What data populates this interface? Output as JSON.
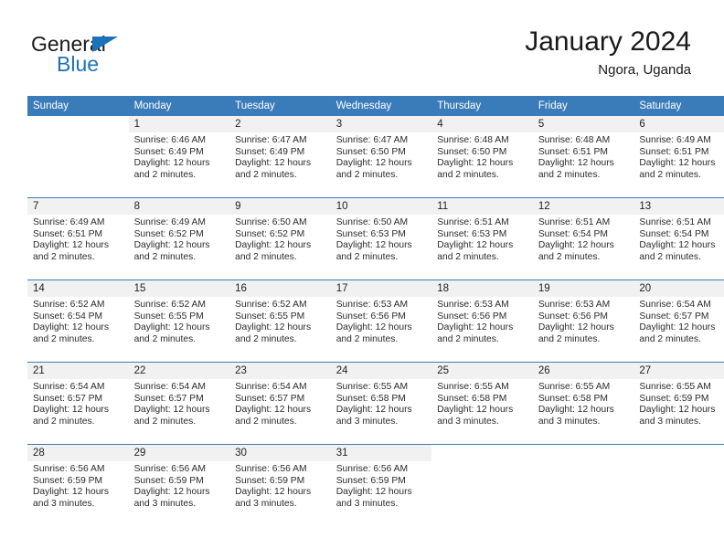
{
  "brand": {
    "name_top": "General",
    "name_bottom": "Blue",
    "triangle_color": "#1c72b8"
  },
  "header": {
    "title": "January 2024",
    "subtitle": "Ngora, Uganda",
    "accent_color": "#3a7cba",
    "daynum_band_color": "#f1f1f1"
  },
  "weekday_headers": [
    "Sunday",
    "Monday",
    "Tuesday",
    "Wednesday",
    "Thursday",
    "Friday",
    "Saturday"
  ],
  "weeks": [
    [
      {
        "day": "",
        "sunrise": "",
        "sunset": "",
        "daylight_line1": "",
        "daylight_line2": "",
        "blank": true
      },
      {
        "day": "1",
        "sunrise": "Sunrise: 6:46 AM",
        "sunset": "Sunset: 6:49 PM",
        "daylight_line1": "Daylight: 12 hours",
        "daylight_line2": "and 2 minutes.",
        "blank": false
      },
      {
        "day": "2",
        "sunrise": "Sunrise: 6:47 AM",
        "sunset": "Sunset: 6:49 PM",
        "daylight_line1": "Daylight: 12 hours",
        "daylight_line2": "and 2 minutes.",
        "blank": false
      },
      {
        "day": "3",
        "sunrise": "Sunrise: 6:47 AM",
        "sunset": "Sunset: 6:50 PM",
        "daylight_line1": "Daylight: 12 hours",
        "daylight_line2": "and 2 minutes.",
        "blank": false
      },
      {
        "day": "4",
        "sunrise": "Sunrise: 6:48 AM",
        "sunset": "Sunset: 6:50 PM",
        "daylight_line1": "Daylight: 12 hours",
        "daylight_line2": "and 2 minutes.",
        "blank": false
      },
      {
        "day": "5",
        "sunrise": "Sunrise: 6:48 AM",
        "sunset": "Sunset: 6:51 PM",
        "daylight_line1": "Daylight: 12 hours",
        "daylight_line2": "and 2 minutes.",
        "blank": false
      },
      {
        "day": "6",
        "sunrise": "Sunrise: 6:49 AM",
        "sunset": "Sunset: 6:51 PM",
        "daylight_line1": "Daylight: 12 hours",
        "daylight_line2": "and 2 minutes.",
        "blank": false
      }
    ],
    [
      {
        "day": "7",
        "sunrise": "Sunrise: 6:49 AM",
        "sunset": "Sunset: 6:51 PM",
        "daylight_line1": "Daylight: 12 hours",
        "daylight_line2": "and 2 minutes.",
        "blank": false
      },
      {
        "day": "8",
        "sunrise": "Sunrise: 6:49 AM",
        "sunset": "Sunset: 6:52 PM",
        "daylight_line1": "Daylight: 12 hours",
        "daylight_line2": "and 2 minutes.",
        "blank": false
      },
      {
        "day": "9",
        "sunrise": "Sunrise: 6:50 AM",
        "sunset": "Sunset: 6:52 PM",
        "daylight_line1": "Daylight: 12 hours",
        "daylight_line2": "and 2 minutes.",
        "blank": false
      },
      {
        "day": "10",
        "sunrise": "Sunrise: 6:50 AM",
        "sunset": "Sunset: 6:53 PM",
        "daylight_line1": "Daylight: 12 hours",
        "daylight_line2": "and 2 minutes.",
        "blank": false
      },
      {
        "day": "11",
        "sunrise": "Sunrise: 6:51 AM",
        "sunset": "Sunset: 6:53 PM",
        "daylight_line1": "Daylight: 12 hours",
        "daylight_line2": "and 2 minutes.",
        "blank": false
      },
      {
        "day": "12",
        "sunrise": "Sunrise: 6:51 AM",
        "sunset": "Sunset: 6:54 PM",
        "daylight_line1": "Daylight: 12 hours",
        "daylight_line2": "and 2 minutes.",
        "blank": false
      },
      {
        "day": "13",
        "sunrise": "Sunrise: 6:51 AM",
        "sunset": "Sunset: 6:54 PM",
        "daylight_line1": "Daylight: 12 hours",
        "daylight_line2": "and 2 minutes.",
        "blank": false
      }
    ],
    [
      {
        "day": "14",
        "sunrise": "Sunrise: 6:52 AM",
        "sunset": "Sunset: 6:54 PM",
        "daylight_line1": "Daylight: 12 hours",
        "daylight_line2": "and 2 minutes.",
        "blank": false
      },
      {
        "day": "15",
        "sunrise": "Sunrise: 6:52 AM",
        "sunset": "Sunset: 6:55 PM",
        "daylight_line1": "Daylight: 12 hours",
        "daylight_line2": "and 2 minutes.",
        "blank": false
      },
      {
        "day": "16",
        "sunrise": "Sunrise: 6:52 AM",
        "sunset": "Sunset: 6:55 PM",
        "daylight_line1": "Daylight: 12 hours",
        "daylight_line2": "and 2 minutes.",
        "blank": false
      },
      {
        "day": "17",
        "sunrise": "Sunrise: 6:53 AM",
        "sunset": "Sunset: 6:56 PM",
        "daylight_line1": "Daylight: 12 hours",
        "daylight_line2": "and 2 minutes.",
        "blank": false
      },
      {
        "day": "18",
        "sunrise": "Sunrise: 6:53 AM",
        "sunset": "Sunset: 6:56 PM",
        "daylight_line1": "Daylight: 12 hours",
        "daylight_line2": "and 2 minutes.",
        "blank": false
      },
      {
        "day": "19",
        "sunrise": "Sunrise: 6:53 AM",
        "sunset": "Sunset: 6:56 PM",
        "daylight_line1": "Daylight: 12 hours",
        "daylight_line2": "and 2 minutes.",
        "blank": false
      },
      {
        "day": "20",
        "sunrise": "Sunrise: 6:54 AM",
        "sunset": "Sunset: 6:57 PM",
        "daylight_line1": "Daylight: 12 hours",
        "daylight_line2": "and 2 minutes.",
        "blank": false
      }
    ],
    [
      {
        "day": "21",
        "sunrise": "Sunrise: 6:54 AM",
        "sunset": "Sunset: 6:57 PM",
        "daylight_line1": "Daylight: 12 hours",
        "daylight_line2": "and 2 minutes.",
        "blank": false
      },
      {
        "day": "22",
        "sunrise": "Sunrise: 6:54 AM",
        "sunset": "Sunset: 6:57 PM",
        "daylight_line1": "Daylight: 12 hours",
        "daylight_line2": "and 2 minutes.",
        "blank": false
      },
      {
        "day": "23",
        "sunrise": "Sunrise: 6:54 AM",
        "sunset": "Sunset: 6:57 PM",
        "daylight_line1": "Daylight: 12 hours",
        "daylight_line2": "and 2 minutes.",
        "blank": false
      },
      {
        "day": "24",
        "sunrise": "Sunrise: 6:55 AM",
        "sunset": "Sunset: 6:58 PM",
        "daylight_line1": "Daylight: 12 hours",
        "daylight_line2": "and 3 minutes.",
        "blank": false
      },
      {
        "day": "25",
        "sunrise": "Sunrise: 6:55 AM",
        "sunset": "Sunset: 6:58 PM",
        "daylight_line1": "Daylight: 12 hours",
        "daylight_line2": "and 3 minutes.",
        "blank": false
      },
      {
        "day": "26",
        "sunrise": "Sunrise: 6:55 AM",
        "sunset": "Sunset: 6:58 PM",
        "daylight_line1": "Daylight: 12 hours",
        "daylight_line2": "and 3 minutes.",
        "blank": false
      },
      {
        "day": "27",
        "sunrise": "Sunrise: 6:55 AM",
        "sunset": "Sunset: 6:59 PM",
        "daylight_line1": "Daylight: 12 hours",
        "daylight_line2": "and 3 minutes.",
        "blank": false
      }
    ],
    [
      {
        "day": "28",
        "sunrise": "Sunrise: 6:56 AM",
        "sunset": "Sunset: 6:59 PM",
        "daylight_line1": "Daylight: 12 hours",
        "daylight_line2": "and 3 minutes.",
        "blank": false
      },
      {
        "day": "29",
        "sunrise": "Sunrise: 6:56 AM",
        "sunset": "Sunset: 6:59 PM",
        "daylight_line1": "Daylight: 12 hours",
        "daylight_line2": "and 3 minutes.",
        "blank": false
      },
      {
        "day": "30",
        "sunrise": "Sunrise: 6:56 AM",
        "sunset": "Sunset: 6:59 PM",
        "daylight_line1": "Daylight: 12 hours",
        "daylight_line2": "and 3 minutes.",
        "blank": false
      },
      {
        "day": "31",
        "sunrise": "Sunrise: 6:56 AM",
        "sunset": "Sunset: 6:59 PM",
        "daylight_line1": "Daylight: 12 hours",
        "daylight_line2": "and 3 minutes.",
        "blank": false
      },
      {
        "day": "",
        "sunrise": "",
        "sunset": "",
        "daylight_line1": "",
        "daylight_line2": "",
        "blank": true
      },
      {
        "day": "",
        "sunrise": "",
        "sunset": "",
        "daylight_line1": "",
        "daylight_line2": "",
        "blank": true
      },
      {
        "day": "",
        "sunrise": "",
        "sunset": "",
        "daylight_line1": "",
        "daylight_line2": "",
        "blank": true
      }
    ]
  ]
}
